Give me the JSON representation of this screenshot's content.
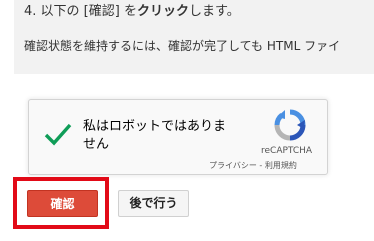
{
  "instructions": {
    "step_prefix": "4. 以下の [",
    "step_confirm_word": "確認",
    "step_middle": "] を",
    "step_click_word": "クリック",
    "step_suffix": "します。",
    "note": "確認状態を維持するには、確認が完了しても HTML ファイ"
  },
  "recaptcha": {
    "label": "私はロボットではありません",
    "brand": "reCAPTCHA",
    "privacy_link": "プライバシー",
    "separator": " - ",
    "terms_link": "利用規約",
    "checked": true,
    "check_color": "#0f9d58"
  },
  "actions": {
    "confirm_label": "確認",
    "later_label": "後で行う",
    "confirm_color": "#dd4b39",
    "highlight_color": "#e20a17"
  }
}
